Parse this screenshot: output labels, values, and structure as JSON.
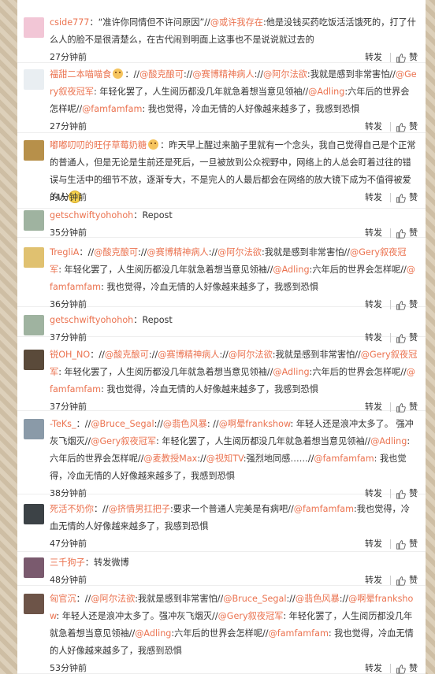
{
  "actions": {
    "repost": "转发",
    "like": "赞"
  },
  "comments": [
    {
      "name": "cside777",
      "segments": [
        {
          "t": "text",
          "v": "：“准许你同情但不许问原因”//"
        },
        {
          "t": "mention",
          "v": "@或许我存在"
        },
        {
          "t": "text",
          "v": ":他是没钱买药吃饭活活饿死的，打了什么人的脸不是很清楚么，在古代闹到明面上这事也不是说说就过去的"
        }
      ],
      "time": "27分钟前",
      "avatar_color": "#f2c6d6"
    },
    {
      "name": "福甜二本喵喵食",
      "segments": [
        {
          "t": "emoji",
          "v": "face"
        },
        {
          "t": "text",
          "v": "：//"
        },
        {
          "t": "mention",
          "v": "@酸克酿可"
        },
        {
          "t": "text",
          "v": "://"
        },
        {
          "t": "mention",
          "v": "@赛博精神病人"
        },
        {
          "t": "text",
          "v": "://"
        },
        {
          "t": "mention",
          "v": "@阿尔法欲"
        },
        {
          "t": "text",
          "v": ":我就是感到非常害怕//"
        },
        {
          "t": "mention",
          "v": "@Gery叙夜冠军"
        },
        {
          "t": "text",
          "v": ": 年轻化罢了，人生阅历都没几年就急着想当意见领袖//"
        },
        {
          "t": "mention",
          "v": "@Adling"
        },
        {
          "t": "text",
          "v": ":六年后的世界会怎样呢//"
        },
        {
          "t": "mention",
          "v": "@famfamfam"
        },
        {
          "t": "text",
          "v": ": 我也觉得，冷血无情的人好像越来越多了，我感到恐惧"
        }
      ],
      "time": "27分钟前",
      "avatar_color": "#e9eef2"
    },
    {
      "name": "嘟嘟叨叨的旺仔草莓奶糖",
      "segments": [
        {
          "t": "emoji",
          "v": "face"
        },
        {
          "t": "text",
          "v": "：昨天早上醒过来脑子里就有一个念头，我自己觉得自己是个正常的普通人，但是无论是生前还是死后，一旦被放到公众视野中，网络上的人总会盯着过往的错误与生活中的细节不放，逐渐专大，不是完人的人最后都会在网络的放大镜下成为不值得被爱的人"
        },
        {
          "t": "smile",
          "v": "smile"
        }
      ],
      "time": "34分钟前",
      "avatar_color": "#b7904a"
    },
    {
      "name": "getschwiftyohohoh",
      "segments": [
        {
          "t": "text",
          "v": "：Repost"
        }
      ],
      "time": "35分钟前",
      "avatar_color": "#9fb3a0"
    },
    {
      "name": "TregliA",
      "segments": [
        {
          "t": "text",
          "v": "：//"
        },
        {
          "t": "mention",
          "v": "@酸克酿可"
        },
        {
          "t": "text",
          "v": "://"
        },
        {
          "t": "mention",
          "v": "@赛博精神病人"
        },
        {
          "t": "text",
          "v": "://"
        },
        {
          "t": "mention",
          "v": "@阿尔法欲"
        },
        {
          "t": "text",
          "v": ":我就是感到非常害怕//"
        },
        {
          "t": "mention",
          "v": "@Gery叙夜冠军"
        },
        {
          "t": "text",
          "v": ": 年轻化罢了，人生阅历都没几年就急着想当意见领袖//"
        },
        {
          "t": "mention",
          "v": "@Adling"
        },
        {
          "t": "text",
          "v": ":六年后的世界会怎样呢//"
        },
        {
          "t": "mention",
          "v": "@famfamfam"
        },
        {
          "t": "text",
          "v": ": 我也觉得，冷血无情的人好像越来越多了，我感到恐惧"
        }
      ],
      "time": "36分钟前",
      "avatar_color": "#e0c170"
    },
    {
      "name": "getschwiftyohohoh",
      "segments": [
        {
          "t": "text",
          "v": "：Repost"
        }
      ],
      "time": "37分钟前",
      "avatar_color": "#9fb3a0"
    },
    {
      "name": "锐OH_NO",
      "segments": [
        {
          "t": "text",
          "v": "：//"
        },
        {
          "t": "mention",
          "v": "@酸克酿可"
        },
        {
          "t": "text",
          "v": "://"
        },
        {
          "t": "mention",
          "v": "@赛博精神病人"
        },
        {
          "t": "text",
          "v": "://"
        },
        {
          "t": "mention",
          "v": "@阿尔法欲"
        },
        {
          "t": "text",
          "v": ":我就是感到非常害怕//"
        },
        {
          "t": "mention",
          "v": "@Gery叙夜冠军"
        },
        {
          "t": "text",
          "v": ": 年轻化罢了，人生阅历都没几年就急着想当意见领袖//"
        },
        {
          "t": "mention",
          "v": "@Adling"
        },
        {
          "t": "text",
          "v": ":六年后的世界会怎样呢//"
        },
        {
          "t": "mention",
          "v": "@famfamfam"
        },
        {
          "t": "text",
          "v": ": 我也觉得，冷血无情的人好像越来越多了，我感到恐惧"
        }
      ],
      "time": "37分钟前",
      "avatar_color": "#5a4a3a"
    },
    {
      "name": "-TeKs_",
      "segments": [
        {
          "t": "text",
          "v": "：//"
        },
        {
          "t": "mention",
          "v": "@Bruce_Segal"
        },
        {
          "t": "text",
          "v": "://"
        },
        {
          "t": "mention",
          "v": "@翡色风暴"
        },
        {
          "t": "text",
          "v": ": //"
        },
        {
          "t": "mention",
          "v": "@啊晕frankshow"
        },
        {
          "t": "text",
          "v": ": 年轻人还是浪冲太多了。 强冲灰飞烟灭//"
        },
        {
          "t": "mention",
          "v": "@Gery叙夜冠军"
        },
        {
          "t": "text",
          "v": ": 年轻化罢了，人生阅历都没几年就急着想当意见领袖//"
        },
        {
          "t": "mention",
          "v": "@Adling"
        },
        {
          "t": "text",
          "v": ":六年后的世界会怎样呢//"
        },
        {
          "t": "mention",
          "v": "@麦教授Max"
        },
        {
          "t": "text",
          "v": "://"
        },
        {
          "t": "mention",
          "v": "@视知TV"
        },
        {
          "t": "text",
          "v": ":强烈地同感……//"
        },
        {
          "t": "mention",
          "v": "@famfamfam"
        },
        {
          "t": "text",
          "v": ": 我也觉得，冷血无情的人好像越来越多了，我感到恐惧"
        }
      ],
      "time": "38分钟前",
      "avatar_color": "#8a9aa8"
    },
    {
      "name": "死活不奶你",
      "segments": [
        {
          "t": "text",
          "v": "：//"
        },
        {
          "t": "mention",
          "v": "@挤情男扛把子"
        },
        {
          "t": "text",
          "v": ":要求一个普通人完美是有病吧//"
        },
        {
          "t": "mention",
          "v": "@famfamfam"
        },
        {
          "t": "text",
          "v": ":我也觉得，冷血无情的人好像越来越多了，我感到恐惧"
        }
      ],
      "time": "47分钟前",
      "avatar_color": "#3c4246"
    },
    {
      "name": "三千狗子",
      "segments": [
        {
          "t": "text",
          "v": "：转发微博"
        }
      ],
      "time": "48分钟前",
      "avatar_color": "#7a5a6e"
    },
    {
      "name": "匈官沉",
      "segments": [
        {
          "t": "text",
          "v": "：//"
        },
        {
          "t": "mention",
          "v": "@阿尔法欲"
        },
        {
          "t": "text",
          "v": ":我就是感到非常害怕//"
        },
        {
          "t": "mention",
          "v": "@Bruce_Segal"
        },
        {
          "t": "text",
          "v": "://"
        },
        {
          "t": "mention",
          "v": "@翡色风暴"
        },
        {
          "t": "text",
          "v": "://"
        },
        {
          "t": "mention",
          "v": "@啊晕frankshow"
        },
        {
          "t": "text",
          "v": ": 年轻人还是浪冲太多了。强冲灰飞烟灭//"
        },
        {
          "t": "mention",
          "v": "@Gery叙夜冠军"
        },
        {
          "t": "text",
          "v": ": 年轻化罢了，人生阅历都没几年就急着想当意见领袖//"
        },
        {
          "t": "mention",
          "v": "@Adling"
        },
        {
          "t": "text",
          "v": ":六年后的世界会怎样呢//"
        },
        {
          "t": "mention",
          "v": "@famfamfam"
        },
        {
          "t": "text",
          "v": ": 我也觉得，冷血无情的人好像越来越多了，我感到恐惧"
        }
      ],
      "time": "53分钟前",
      "avatar_color": "#6d5448"
    }
  ]
}
